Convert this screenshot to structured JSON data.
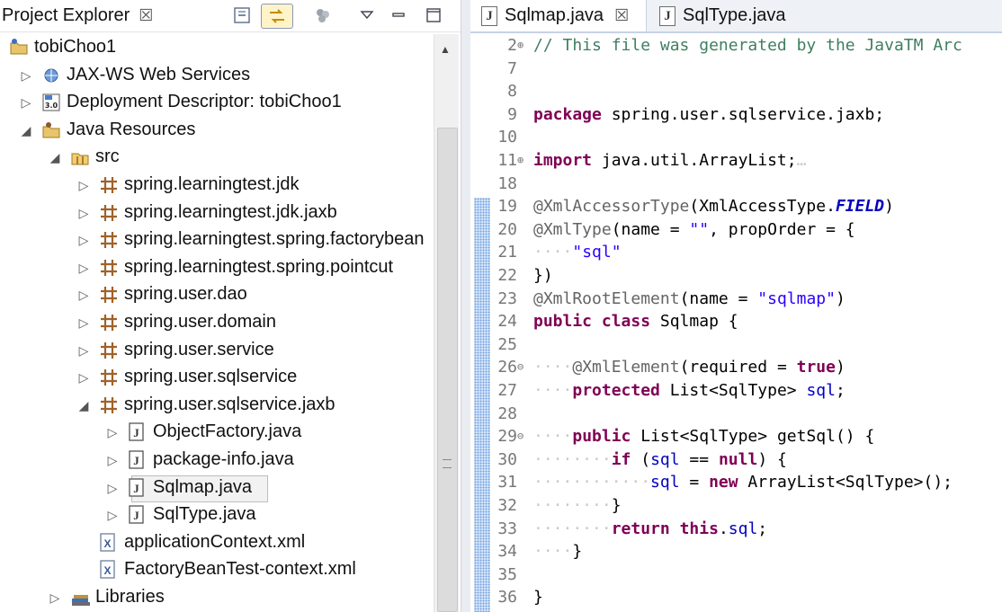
{
  "explorer": {
    "title": "Project Explorer",
    "close_glyph": "☒",
    "toolbar": {
      "collapse_all_icon": "collapse-all-icon",
      "link_with_editor_icon": "link-with-editor-icon",
      "filter_icon": "filter-icon",
      "view_menu_icon": "view-menu-icon",
      "minimize_icon": "minimize-icon",
      "maximize_icon": "maximize-icon"
    },
    "tree": [
      {
        "label": "tobiChoo1",
        "icon": "project-icon",
        "level": 0,
        "toggle": ""
      },
      {
        "label": "JAX-WS Web Services",
        "icon": "web-services-icon",
        "level": 1,
        "toggle": "▷"
      },
      {
        "label": "Deployment Descriptor: tobiChoo1",
        "icon": "deployment-descriptor-icon",
        "level": 1,
        "toggle": "▷"
      },
      {
        "label": "Java Resources",
        "icon": "java-resources-icon",
        "level": 1,
        "toggle": "◢"
      },
      {
        "label": "src",
        "icon": "source-folder-icon",
        "level": 2,
        "toggle": "◢"
      },
      {
        "label": "spring.learningtest.jdk",
        "icon": "package-icon",
        "level": 3,
        "toggle": "▷"
      },
      {
        "label": "spring.learningtest.jdk.jaxb",
        "icon": "package-icon",
        "level": 3,
        "toggle": "▷"
      },
      {
        "label": "spring.learningtest.spring.factorybean",
        "icon": "package-icon",
        "level": 3,
        "toggle": "▷"
      },
      {
        "label": "spring.learningtest.spring.pointcut",
        "icon": "package-icon",
        "level": 3,
        "toggle": "▷"
      },
      {
        "label": "spring.user.dao",
        "icon": "package-icon",
        "level": 3,
        "toggle": "▷"
      },
      {
        "label": "spring.user.domain",
        "icon": "package-icon",
        "level": 3,
        "toggle": "▷"
      },
      {
        "label": "spring.user.service",
        "icon": "package-icon",
        "level": 3,
        "toggle": "▷"
      },
      {
        "label": "spring.user.sqlservice",
        "icon": "package-icon",
        "level": 3,
        "toggle": "▷"
      },
      {
        "label": "spring.user.sqlservice.jaxb",
        "icon": "package-icon",
        "level": 3,
        "toggle": "◢"
      },
      {
        "label": "ObjectFactory.java",
        "icon": "java-file-icon",
        "level": 4,
        "toggle": "▷"
      },
      {
        "label": "package-info.java",
        "icon": "java-file-icon",
        "level": 4,
        "toggle": "▷"
      },
      {
        "label": "Sqlmap.java",
        "icon": "java-file-icon",
        "level": 4,
        "toggle": "▷",
        "selected": true
      },
      {
        "label": "SqlType.java",
        "icon": "java-file-icon",
        "level": 4,
        "toggle": "▷"
      },
      {
        "label": "applicationContext.xml",
        "icon": "xml-file-icon",
        "level": 3,
        "toggle": ""
      },
      {
        "label": "FactoryBeanTest-context.xml",
        "icon": "xml-file-icon",
        "level": 3,
        "toggle": ""
      },
      {
        "label": "Libraries",
        "icon": "libraries-icon",
        "level": 2,
        "toggle": "▷"
      }
    ]
  },
  "editor": {
    "tabs": [
      {
        "label": "Sqlmap.java",
        "active": true,
        "close_glyph": "☒"
      },
      {
        "label": "SqlType.java",
        "active": false
      }
    ],
    "lines": [
      {
        "n": "2",
        "fold": "⊕",
        "segs": [
          [
            "cm",
            "// This file was generated by the JavaTM Arc"
          ]
        ]
      },
      {
        "n": "7",
        "fold": "",
        "segs": []
      },
      {
        "n": "8",
        "fold": "",
        "segs": []
      },
      {
        "n": "9",
        "fold": "",
        "segs": [
          [
            "kw",
            "package"
          ],
          [
            "",
            " spring.user.sqlservice.jaxb;"
          ]
        ]
      },
      {
        "n": "10",
        "fold": "",
        "segs": []
      },
      {
        "n": "11",
        "fold": "⊕",
        "segs": [
          [
            "kw",
            "import"
          ],
          [
            "",
            " java.util.ArrayList;"
          ],
          [
            "ws",
            "…"
          ]
        ]
      },
      {
        "n": "18",
        "fold": "",
        "segs": []
      },
      {
        "n": "19",
        "fold": "",
        "segs": [
          [
            "an",
            "@XmlAccessorType"
          ],
          [
            "",
            "(XmlAccessType."
          ],
          [
            "fi",
            "FIELD"
          ],
          [
            "",
            ")"
          ]
        ]
      },
      {
        "n": "20",
        "fold": "",
        "segs": [
          [
            "an",
            "@XmlType"
          ],
          [
            "",
            "(name = "
          ],
          [
            "st",
            "\"\""
          ],
          [
            "",
            ", propOrder = {"
          ]
        ]
      },
      {
        "n": "21",
        "fold": "",
        "segs": [
          [
            "ws",
            "····"
          ],
          [
            "st",
            "\"sql\""
          ]
        ]
      },
      {
        "n": "22",
        "fold": "",
        "segs": [
          [
            "",
            "})"
          ]
        ]
      },
      {
        "n": "23",
        "fold": "",
        "segs": [
          [
            "an",
            "@XmlRootElement"
          ],
          [
            "",
            "(name = "
          ],
          [
            "st",
            "\"sqlmap\""
          ],
          [
            "",
            ")"
          ]
        ]
      },
      {
        "n": "24",
        "fold": "",
        "segs": [
          [
            "kw",
            "public"
          ],
          [
            "",
            " "
          ],
          [
            "kw",
            "class"
          ],
          [
            "",
            " Sqlmap {"
          ]
        ]
      },
      {
        "n": "25",
        "fold": "",
        "segs": []
      },
      {
        "n": "26",
        "fold": "⊖",
        "segs": [
          [
            "ws",
            "····"
          ],
          [
            "an",
            "@XmlElement"
          ],
          [
            "",
            "(required = "
          ],
          [
            "kw",
            "true"
          ],
          [
            "",
            ")"
          ]
        ]
      },
      {
        "n": "27",
        "fold": "",
        "segs": [
          [
            "ws",
            "····"
          ],
          [
            "kw",
            "protected"
          ],
          [
            "",
            " List<SqlType> "
          ],
          [
            "fd",
            "sql"
          ],
          [
            "",
            ";"
          ]
        ]
      },
      {
        "n": "28",
        "fold": "",
        "segs": []
      },
      {
        "n": "29",
        "fold": "⊖",
        "segs": [
          [
            "ws",
            "····"
          ],
          [
            "kw",
            "public"
          ],
          [
            "",
            " List<SqlType> getSql() {"
          ]
        ]
      },
      {
        "n": "30",
        "fold": "",
        "segs": [
          [
            "ws",
            "········"
          ],
          [
            "kw",
            "if"
          ],
          [
            "",
            " ("
          ],
          [
            "fd",
            "sql"
          ],
          [
            "",
            " == "
          ],
          [
            "kw",
            "null"
          ],
          [
            "",
            ") {"
          ]
        ]
      },
      {
        "n": "31",
        "fold": "",
        "segs": [
          [
            "ws",
            "············"
          ],
          [
            "fd",
            "sql"
          ],
          [
            "",
            " = "
          ],
          [
            "kw",
            "new"
          ],
          [
            "",
            " ArrayList<SqlType>();"
          ]
        ]
      },
      {
        "n": "32",
        "fold": "",
        "segs": [
          [
            "ws",
            "········"
          ],
          [
            "",
            "}"
          ]
        ]
      },
      {
        "n": "33",
        "fold": "",
        "segs": [
          [
            "ws",
            "········"
          ],
          [
            "kw",
            "return"
          ],
          [
            "",
            " "
          ],
          [
            "kw",
            "this"
          ],
          [
            "",
            "."
          ],
          [
            "fd",
            "sql"
          ],
          [
            "",
            ";"
          ]
        ]
      },
      {
        "n": "34",
        "fold": "",
        "segs": [
          [
            "ws",
            "····"
          ],
          [
            "",
            "}"
          ]
        ]
      },
      {
        "n": "35",
        "fold": "",
        "segs": []
      },
      {
        "n": "36",
        "fold": "",
        "segs": [
          [
            "",
            "}"
          ]
        ]
      }
    ]
  },
  "colors": {
    "keyword": "#7f0055",
    "string": "#2a00ff",
    "annotation": "#646464",
    "comment": "#3f7f5f",
    "field": "#0000c0"
  }
}
